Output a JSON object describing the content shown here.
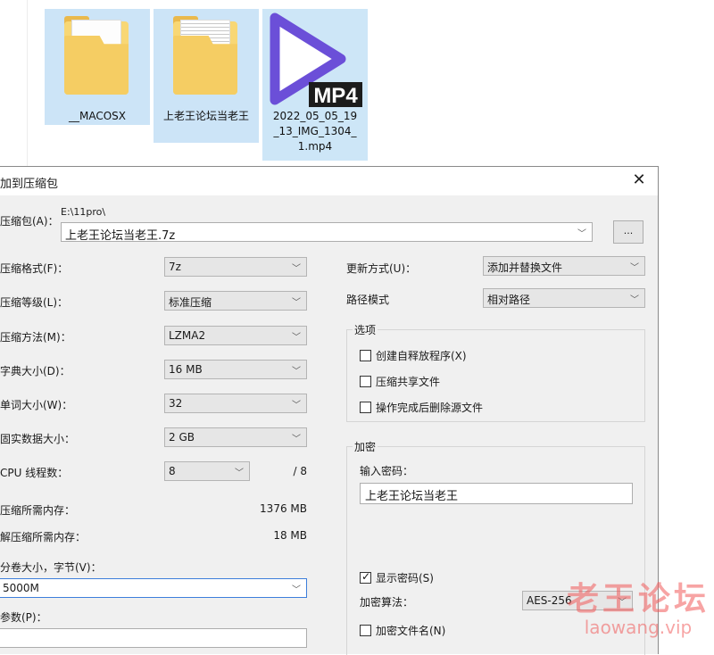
{
  "explorer": {
    "files": [
      {
        "name": "__MACOSX",
        "icon": "folder-icon"
      },
      {
        "name": "上老王论坛当老王",
        "icon": "folder-icon"
      },
      {
        "name": "2022_05_05_19_13_IMG_1304_1.mp4",
        "name_lines": [
          "2022_05_05_19",
          "_13_IMG_1304_",
          "1.mp4"
        ],
        "icon": "mp4-video-icon",
        "badge": "MP4"
      }
    ]
  },
  "dialog": {
    "title": "加到压缩包",
    "close_glyph": "✕",
    "archive": {
      "label": "压缩包(A)：",
      "path": "E:\\11pro\\",
      "filename": "上老王论坛当老王.7z",
      "browse_label": "..."
    },
    "left": {
      "format": {
        "label": "压缩格式(F)：",
        "value": "7z"
      },
      "level": {
        "label": "压缩等级(L)：",
        "value": "标准压缩"
      },
      "method": {
        "label": "压缩方法(M)：",
        "value": "LZMA2"
      },
      "dict": {
        "label": "字典大小(D)：",
        "value": "16 MB"
      },
      "word": {
        "label": "单词大小(W)：",
        "value": "32"
      },
      "solid": {
        "label": "固实数据大小：",
        "value": "2 GB"
      },
      "threads": {
        "label": "CPU 线程数：",
        "value": "8",
        "total": "/ 8"
      },
      "mem_compress": {
        "label": "压缩所需内存：",
        "value": "1376 MB"
      },
      "mem_decompress": {
        "label": "解压缩所需内存：",
        "value": "18 MB"
      },
      "volume": {
        "label": "分卷大小，字节(V)：",
        "value": "5000M"
      },
      "params": {
        "label": "参数(P)：",
        "value": ""
      }
    },
    "right": {
      "update": {
        "label": "更新方式(U)：",
        "value": "添加并替换文件"
      },
      "pathmode": {
        "label": "路径模式",
        "value": "相对路径"
      },
      "options": {
        "title": "选项",
        "items": [
          {
            "label": "创建自释放程序(X)",
            "checked": false
          },
          {
            "label": "压缩共享文件",
            "checked": false
          },
          {
            "label": "操作完成后删除源文件",
            "checked": false
          }
        ]
      },
      "encryption": {
        "title": "加密",
        "pwd_label": "输入密码：",
        "pwd_value": "上老王论坛当老王",
        "show_pwd": {
          "label": "显示密码(S)",
          "checked": true
        },
        "method_label": "加密算法：",
        "method_value": "AES-256",
        "encrypt_names": {
          "label": "加密文件名(N)",
          "checked": false
        }
      }
    }
  },
  "watermark": {
    "line1": "老王论坛",
    "line2": "laowang.vip"
  },
  "colors": {
    "dialog_bg": "#f0f0f0",
    "selection": "#cce4f7",
    "focus_border": "#3d7edb",
    "watermark": "#f05a5a",
    "mp4_purple": "#6b4fd8"
  }
}
